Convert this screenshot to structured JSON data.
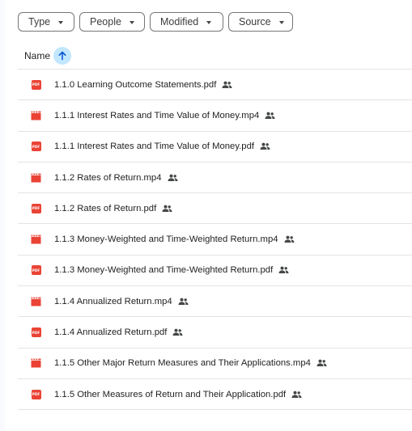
{
  "filters": [
    {
      "label": "Type"
    },
    {
      "label": "People"
    },
    {
      "label": "Modified"
    },
    {
      "label": "Source"
    }
  ],
  "header": {
    "name_label": "Name",
    "sort_direction": "ascending"
  },
  "files": [
    {
      "name": "1.1.0 Learning Outcome Statements.pdf",
      "type": "pdf",
      "shared": true
    },
    {
      "name": "1.1.1 Interest Rates and Time Value of Money.mp4",
      "type": "video",
      "shared": true
    },
    {
      "name": "1.1.1 Interest Rates and Time Value of Money.pdf",
      "type": "pdf",
      "shared": true
    },
    {
      "name": "1.1.2 Rates of Return.mp4",
      "type": "video",
      "shared": true
    },
    {
      "name": "1.1.2 Rates of Return.pdf",
      "type": "pdf",
      "shared": true
    },
    {
      "name": "1.1.3 Money-Weighted and Time-Weighted Return.mp4",
      "type": "video",
      "shared": true
    },
    {
      "name": "1.1.3 Money-Weighted and Time-Weighted Return.pdf",
      "type": "pdf",
      "shared": true
    },
    {
      "name": "1.1.4 Annualized Return.mp4",
      "type": "video",
      "shared": true
    },
    {
      "name": "1.1.4 Annualized Return.pdf",
      "type": "pdf",
      "shared": true
    },
    {
      "name": "1.1.5 Other Major Return Measures and Their Applications.mp4",
      "type": "video",
      "shared": true
    },
    {
      "name": "1.1.5 Other Measures of Return and Their Application.pdf",
      "type": "pdf",
      "shared": true
    }
  ],
  "icons": {
    "pdf_badge_text": "PDF",
    "pdf_color": "#ea4335",
    "video_color": "#ea4335",
    "sort_bg": "#c2e7ff",
    "sort_arrow": "#0b57d0"
  }
}
